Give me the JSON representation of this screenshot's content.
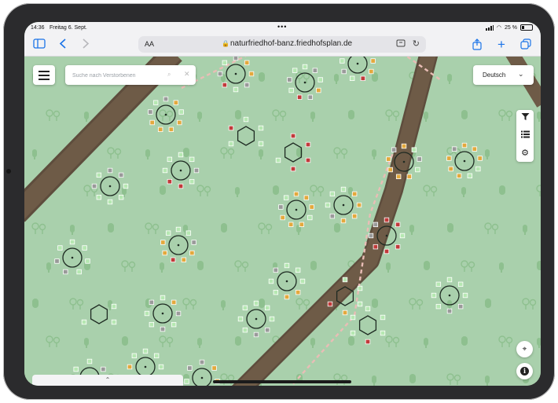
{
  "status": {
    "time": "14:36",
    "date": "Freitag 6. Sept.",
    "battery": "25 %"
  },
  "browser": {
    "reader_label": "AA",
    "url": "naturfriedhof-banz.friedhofsplan.de"
  },
  "search": {
    "placeholder": "Suche nach Verstorbenen"
  },
  "language": {
    "selected": "Deutsch"
  },
  "colors": {
    "map_bg": "#a9d0ac",
    "path": "#6a5846",
    "tree": "#8ec08f",
    "box_green": "#b6e8b2",
    "box_orange": "#e3a93d",
    "box_red": "#c13a3a",
    "box_gray": "#9a9a9a"
  },
  "icons": {
    "menu": "hamburger-icon",
    "filter": "filter-icon",
    "list": "list-icon",
    "settings": "gear-icon",
    "locate": "locate-icon",
    "info": "info-icon"
  }
}
